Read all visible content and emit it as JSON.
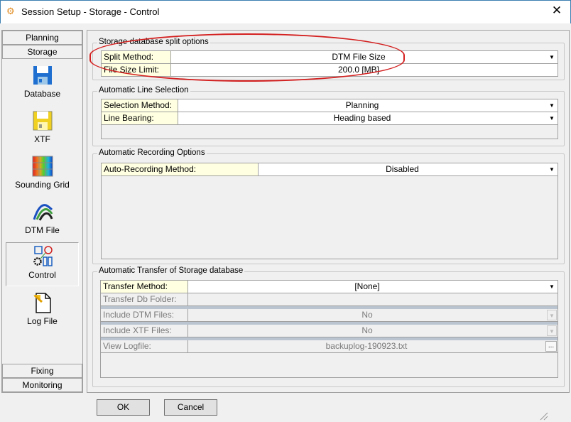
{
  "window": {
    "title": "Session Setup - Storage -  Control",
    "close": "✕"
  },
  "sidebar": {
    "tabs_top": [
      "Planning",
      "Storage"
    ],
    "items": [
      {
        "label": "Database",
        "icon": "floppy-blue-icon"
      },
      {
        "label": "XTF",
        "icon": "floppy-yellow-icon"
      },
      {
        "label": "Sounding Grid",
        "icon": "grid-color-icon"
      },
      {
        "label": "DTM File",
        "icon": "dtm-wave-icon"
      },
      {
        "label": "Control",
        "icon": "control-diagram-icon"
      },
      {
        "label": "Log File",
        "icon": "log-file-icon"
      }
    ],
    "tabs_bottom": [
      "Fixing",
      "Monitoring"
    ]
  },
  "split": {
    "title": "Storage database split options",
    "rows": [
      {
        "label": "Split Method:",
        "value": "DTM File Size"
      },
      {
        "label": "File Size Limit:",
        "value": "200.0 [MB]"
      }
    ]
  },
  "line": {
    "title": "Automatic Line Selection",
    "rows": [
      {
        "label": "Selection Method:",
        "value": "Planning"
      },
      {
        "label": "Line Bearing:",
        "value": "Heading based"
      }
    ]
  },
  "recording": {
    "title": "Automatic Recording Options",
    "rows": [
      {
        "label": "Auto-Recording Method:",
        "value": "Disabled"
      }
    ]
  },
  "transfer": {
    "title": "Automatic Transfer of Storage database",
    "rows": [
      {
        "label": "Transfer Method:",
        "value": "[None]"
      },
      {
        "label": "Transfer Db Folder:",
        "value": ""
      },
      {
        "label": "Include DTM Files:",
        "value": "No"
      },
      {
        "label": "Include XTF Files:",
        "value": "No"
      },
      {
        "label": "View Logfile:",
        "value": "backuplog-190923.txt",
        "button": "..."
      }
    ]
  },
  "buttons": {
    "ok": "OK",
    "cancel": "Cancel"
  },
  "colors": {
    "highlight": "#d42020",
    "label_bg": "#ffffe1"
  }
}
